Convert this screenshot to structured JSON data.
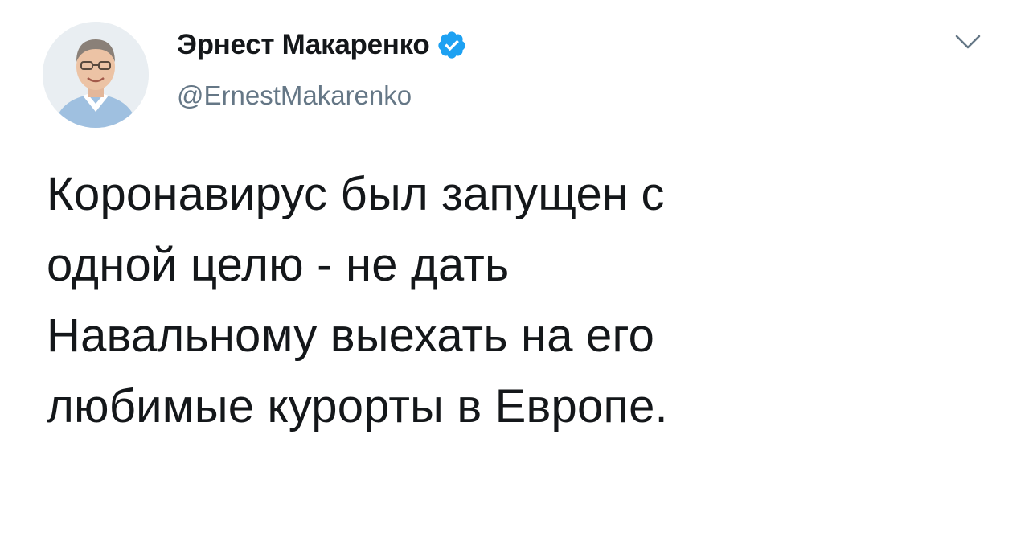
{
  "tweet": {
    "author": {
      "display_name": "Эрнест Макаренко",
      "handle": "@ErnestMakarenko",
      "verified": true,
      "avatar_icon": "avatar-photo",
      "verified_icon": "verified-badge-icon"
    },
    "menu_icon": "chevron-down-icon",
    "text": "Коронавирус был запущен с\nодной целю - не дать\nНавальному выехать на его\nлюбимые курорты в Европе."
  },
  "colors": {
    "text_primary": "#14171a",
    "text_secondary": "#657786",
    "verified_blue": "#1da1f2",
    "background": "#ffffff"
  }
}
